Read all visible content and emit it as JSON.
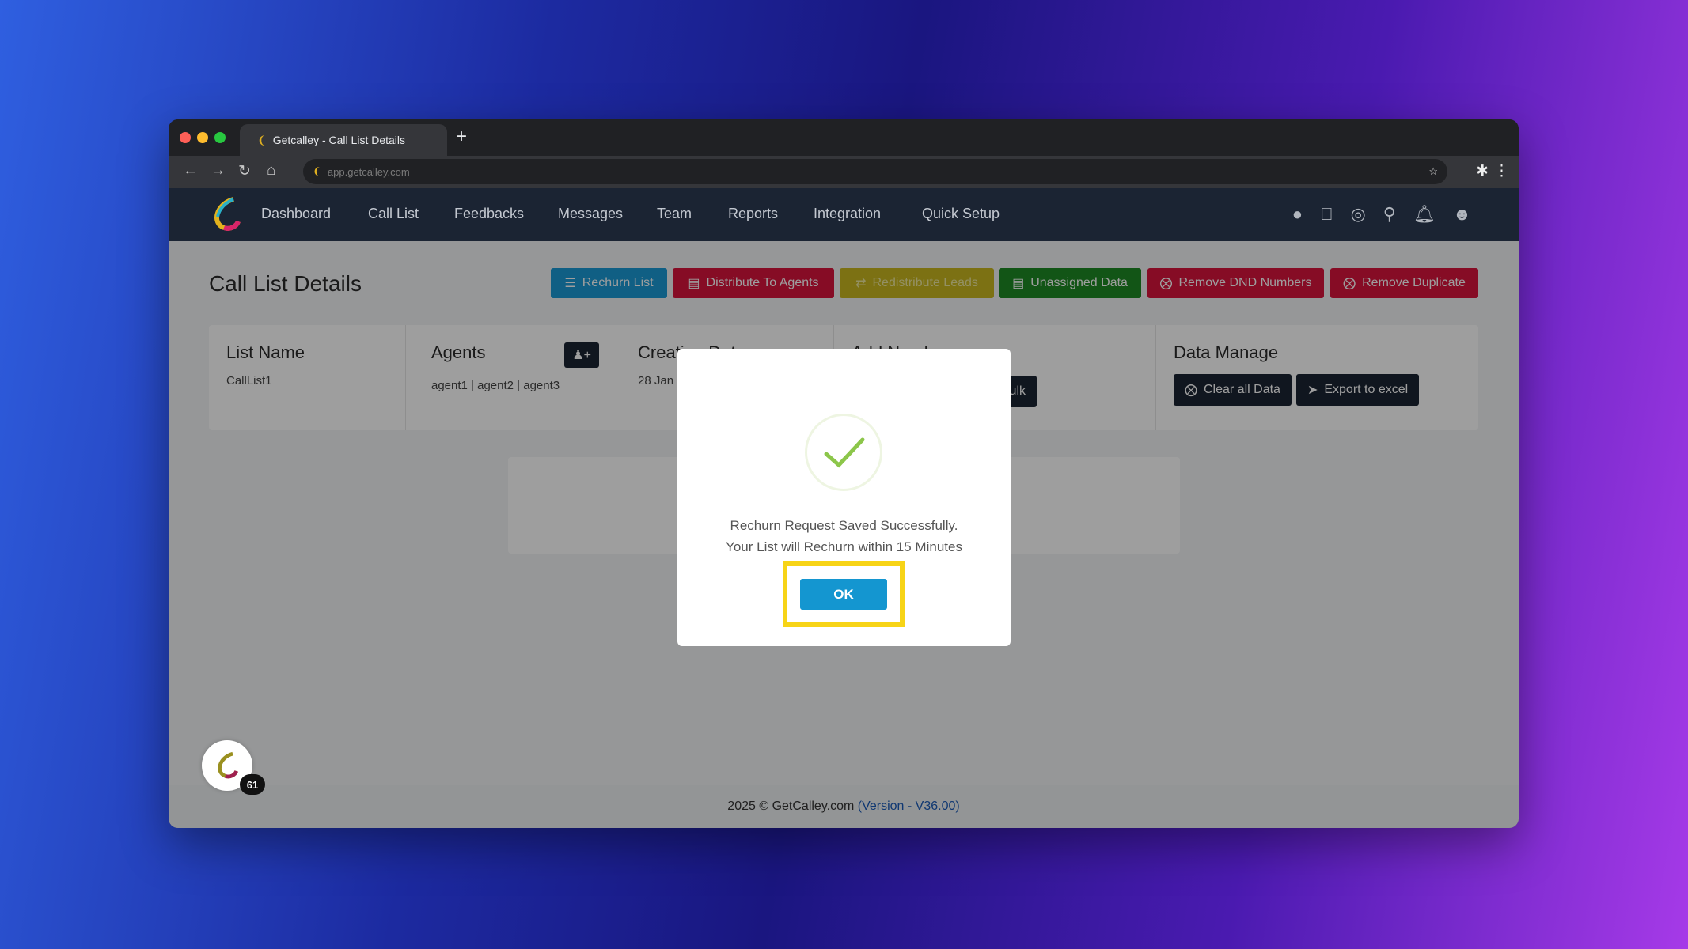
{
  "browser": {
    "tab_title": "Getcalley - Call List Details",
    "url": "app.getcalley.com"
  },
  "nav": {
    "items": [
      "Dashboard",
      "Call List",
      "Feedbacks",
      "Messages",
      "Team",
      "Reports",
      "Integration",
      "Quick Setup"
    ],
    "icons": [
      "android-icon",
      "apple-icon",
      "lifebuoy-icon",
      "search-icon",
      "bell-icon",
      "user-circle-icon"
    ]
  },
  "page": {
    "title": "Call List Details"
  },
  "actions": [
    {
      "label": "Rechurn List",
      "color": "#1a9ad6",
      "icon": "list-icon"
    },
    {
      "label": "Distribute To Agents",
      "color": "#d8143c",
      "icon": "database-icon"
    },
    {
      "label": "Redistribute Leads",
      "color": "#c9b71f",
      "icon": "refresh-icon"
    },
    {
      "label": "Unassigned Data",
      "color": "#1e8a24",
      "icon": "table-icon"
    },
    {
      "label": "Remove DND Numbers",
      "color": "#d8143c",
      "icon": "times-circle-icon"
    },
    {
      "label": "Remove Duplicate",
      "color": "#d8143c",
      "icon": "times-circle-icon"
    }
  ],
  "cards": {
    "list_name": {
      "title": "List Name",
      "value": "CallList1"
    },
    "agents": {
      "title": "Agents",
      "value": "agent1 | agent2 | agent3"
    },
    "creation": {
      "title": "Creation Date",
      "value": "28 Jan"
    },
    "add_numbers": {
      "title": "Add Numbers",
      "button": "Bulk"
    },
    "data_manage": {
      "title": "Data Manage",
      "clear": "Clear all Data",
      "export": "Export to excel"
    }
  },
  "badge_count": "61",
  "footer": {
    "text": "2025 © GetCalley.com ",
    "version": "(Version - V36.00)"
  },
  "modal": {
    "line1": "Rechurn Request Saved Successfully.",
    "line2": "Your List will Rechurn within 15 Minutes",
    "ok": "OK",
    "highlight_color": "#f7d417"
  }
}
